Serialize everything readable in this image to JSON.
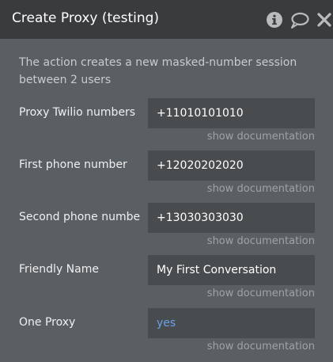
{
  "header": {
    "title": "Create Proxy (testing)"
  },
  "description": "The action creates a new masked-number session between 2 users",
  "fields": [
    {
      "label": "Proxy Twilio numbers",
      "value": "+11010101010",
      "doc": "show documentation"
    },
    {
      "label": "First phone number",
      "value": "+12020202020",
      "doc": "show documentation"
    },
    {
      "label": "Second phone numbe",
      "value": "+13030303030",
      "doc": "show documentation"
    },
    {
      "label": "Friendly Name",
      "value": "My First Conversation",
      "doc": "show documentation"
    },
    {
      "label": "One Proxy",
      "value": "yes",
      "doc": "show documentation"
    }
  ],
  "icons": [
    "info-icon",
    "comment-icon",
    "close-icon"
  ],
  "colors": {
    "panel_bg": "#5a5f63",
    "header_bg": "#3a3b3d",
    "input_bg": "#484c4f",
    "link": "#6ba2e6"
  }
}
